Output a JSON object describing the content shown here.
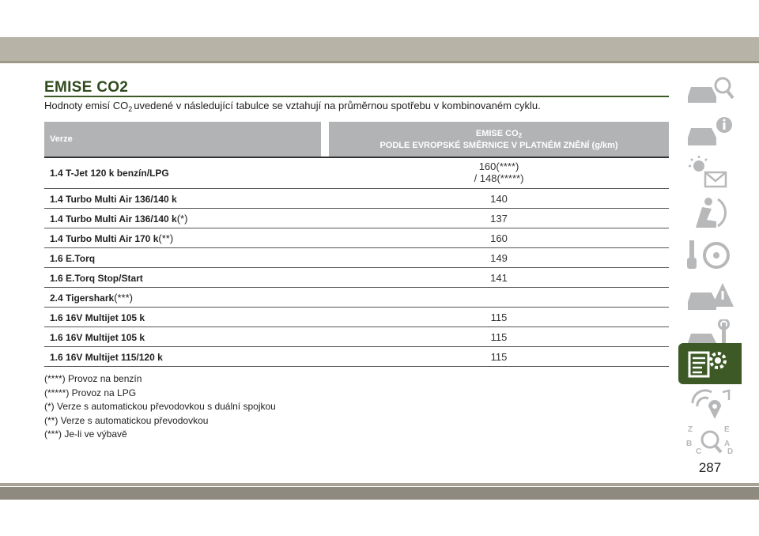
{
  "document": {
    "title": "EMISE CO2",
    "intro_before": "Hodnoty emisí CO",
    "intro_sub": "2",
    "intro_after": "uvedené v následující tabulce se vztahují na průměrnou spotřebu v kombinovaném cyklu."
  },
  "table": {
    "header_col1": "Verze",
    "header_col2_line1": "EMISE CO",
    "header_col2_sub": "2",
    "header_col2_line2": "PODLE EVROPSKÉ SMĚRNICE V PLATNÉM ZNĚNÍ (g/km)",
    "rows": [
      {
        "version": "1.4 T-Jet 120 k benzín/LPG",
        "suffix": "",
        "value_line1": "160(****)",
        "value_line2": "/ 148(*****)"
      },
      {
        "version": "1.4 Turbo Multi Air 136/140 k",
        "suffix": "",
        "value_line1": "140",
        "value_line2": ""
      },
      {
        "version": "1.4 Turbo Multi Air 136/140 k",
        "suffix": "(*)",
        "value_line1": "137",
        "value_line2": ""
      },
      {
        "version": "1.4 Turbo Multi Air 170 k",
        "suffix": "(**)",
        "value_line1": "160",
        "value_line2": ""
      },
      {
        "version": "1.6 E.Torq",
        "suffix": "",
        "value_line1": "149",
        "value_line2": ""
      },
      {
        "version": "1.6 E.Torq Stop/Start",
        "suffix": "",
        "value_line1": "141",
        "value_line2": ""
      },
      {
        "version": "2.4 Tigershark",
        "suffix": "(***)",
        "value_line1": "",
        "value_line2": ""
      },
      {
        "version": "1.6 16V Multijet 105 k",
        "suffix": "",
        "value_line1": "115",
        "value_line2": ""
      },
      {
        "version": "1.6 16V Multijet 105 k",
        "suffix": "",
        "value_line1": "115",
        "value_line2": ""
      },
      {
        "version": "1.6 16V Multijet 115/120 k",
        "suffix": "",
        "value_line1": "115",
        "value_line2": ""
      }
    ]
  },
  "footnotes": [
    "(****) Provoz na benzín",
    "(*****) Provoz na LPG",
    "(*) Verze s automatickou převodovkou s duální spojkou",
    "(**) Verze s automatickou převodovkou",
    "(***) Je-li ve výbavě"
  ],
  "sidebar": {
    "tabs": [
      {
        "icon": "car-search-icon",
        "active": false
      },
      {
        "icon": "car-info-icon",
        "active": false
      },
      {
        "icon": "warning-light-message-icon",
        "active": false
      },
      {
        "icon": "airbag-seat-icon",
        "active": false
      },
      {
        "icon": "key-steering-wheel-icon",
        "active": false
      },
      {
        "icon": "car-emergency-icon",
        "active": false
      },
      {
        "icon": "car-tools-icon",
        "active": false
      },
      {
        "icon": "list-gear-icon",
        "active": true
      },
      {
        "icon": "media-nav-icon",
        "active": false
      },
      {
        "icon": "alphabet-index-icon",
        "active": false
      }
    ],
    "colors": {
      "active": "#3d5a26",
      "icon": "#b7b8ba"
    }
  },
  "page_number": "287"
}
